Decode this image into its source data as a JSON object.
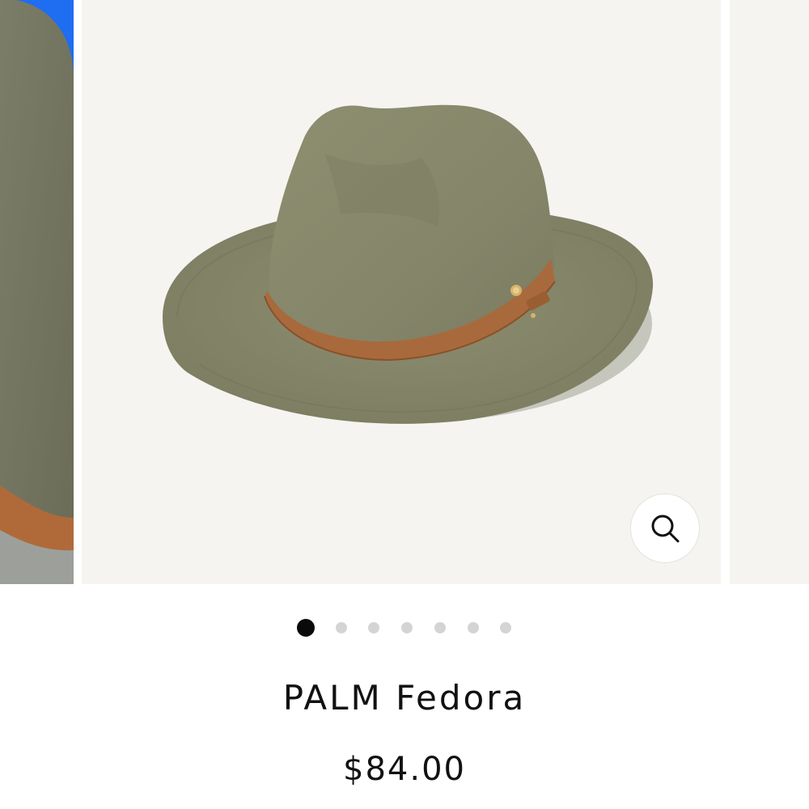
{
  "product": {
    "title": "PALM Fedora",
    "price": "$84.00"
  },
  "gallery": {
    "image_count": 7,
    "active_index": 0,
    "zoom_icon": "search-icon"
  },
  "colors": {
    "image_background": "#f5f4f0",
    "felt_olive": "#8a8a6c",
    "band_tan": "#a86a3c",
    "dot_active": "#0a0a0a",
    "dot_inactive": "#d4d4d4",
    "prev_slide_edge": "#1f6df0"
  }
}
